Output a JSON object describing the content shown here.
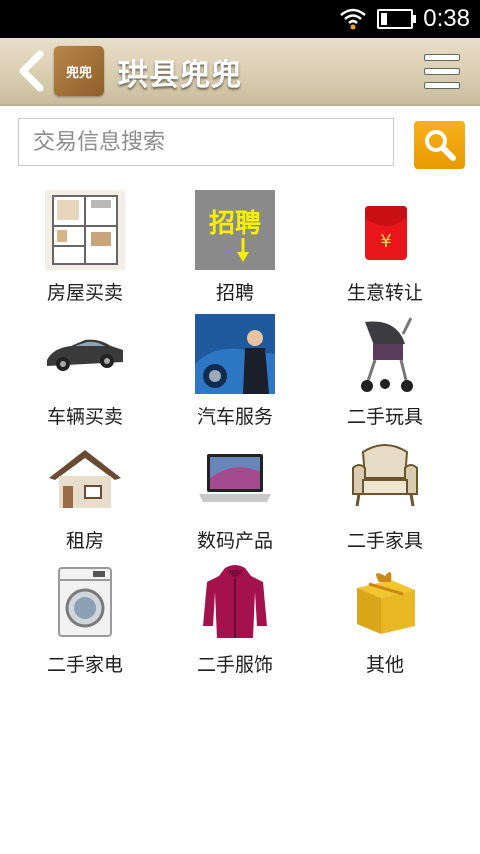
{
  "status": {
    "time": "0:38"
  },
  "header": {
    "title": "珙县兜兜",
    "logo_text": "兜兜"
  },
  "search": {
    "placeholder": "交易信息搜索"
  },
  "categories": [
    {
      "label": "房屋买卖",
      "icon": "floorplan-icon"
    },
    {
      "label": "招聘",
      "icon": "recruit-icon",
      "icon_text": "招聘"
    },
    {
      "label": "生意转让",
      "icon": "red-envelope-icon",
      "icon_text": "¥"
    },
    {
      "label": "车辆买卖",
      "icon": "car-icon"
    },
    {
      "label": "汽车服务",
      "icon": "car-service-icon"
    },
    {
      "label": "二手玩具",
      "icon": "stroller-icon"
    },
    {
      "label": "租房",
      "icon": "house-icon"
    },
    {
      "label": "数码产品",
      "icon": "laptop-icon"
    },
    {
      "label": "二手家具",
      "icon": "armchair-icon"
    },
    {
      "label": "二手家电",
      "icon": "washing-machine-icon"
    },
    {
      "label": "二手服饰",
      "icon": "hoodie-icon"
    },
    {
      "label": "其他",
      "icon": "gift-box-icon"
    }
  ],
  "colors": {
    "accent": "#f0a30a",
    "header": "#d8ccb0"
  }
}
